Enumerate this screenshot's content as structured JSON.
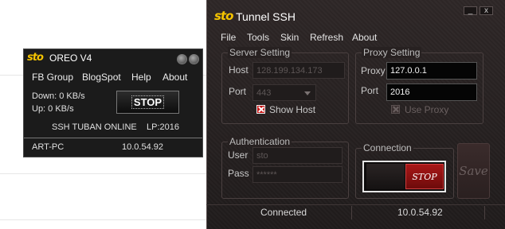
{
  "oreo": {
    "logo": "sto",
    "title": "OREO V4",
    "menu": [
      "FB Group",
      "BlogSpot",
      "Help",
      "About"
    ],
    "down": "Down: 0 KB/s",
    "up": "Up: 0 KB/s",
    "stop_label": "STOP",
    "online": "SSH TUBAN ONLINE",
    "lp": "LP:2016",
    "computer": "ART-PC",
    "ip": "10.0.54.92"
  },
  "tunnel": {
    "logo": "sto",
    "title": "Tunnel SSH",
    "minimize": "_",
    "close": "x",
    "menu": [
      "File",
      "Tools",
      "Skin",
      "Refresh",
      "About"
    ],
    "server": {
      "legend": "Server Setting",
      "host_label": "Host",
      "host_value": "128.199.134.173",
      "port_label": "Port",
      "port_value": "443",
      "show_host": "Show Host",
      "show_host_checked": true
    },
    "proxy": {
      "legend": "Proxy Setting",
      "proxy_label": "Proxy",
      "proxy_value": "127.0.0.1",
      "port_label": "Port",
      "port_value": "2016",
      "use_proxy": "Use Proxy",
      "use_proxy_checked": false
    },
    "auth": {
      "legend": "Authentication",
      "user_label": "User",
      "user_value": "sto",
      "pass_label": "Pass",
      "pass_value": "******"
    },
    "connection": {
      "legend": "Connection",
      "toggle_label": "STOP",
      "save_label": "Save"
    },
    "status": {
      "state": "Connected",
      "ip": "10.0.54.92"
    }
  },
  "colors": {
    "accent_red": "#c81414",
    "logo_yellow": "#f5c400"
  }
}
